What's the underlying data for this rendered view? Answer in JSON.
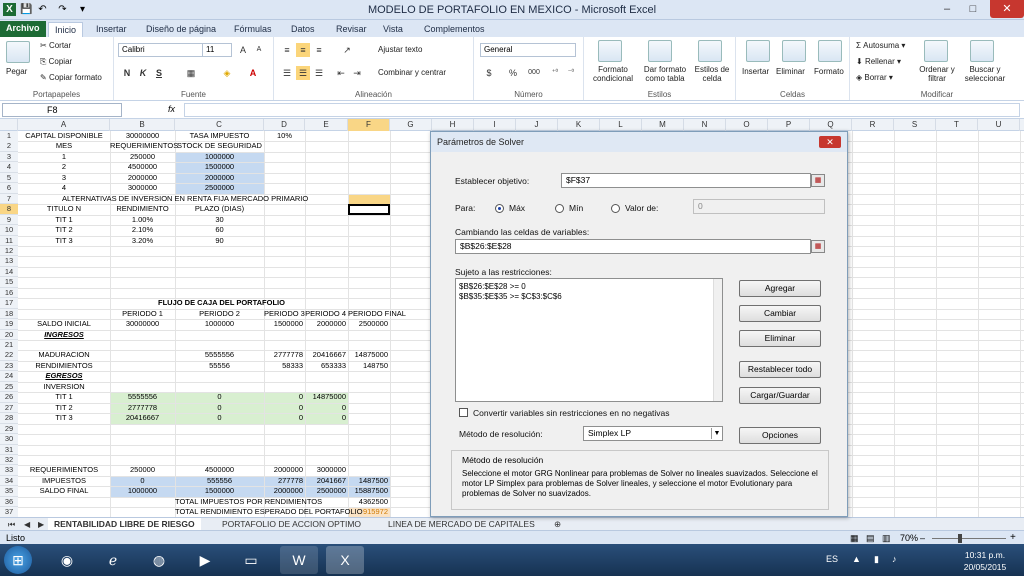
{
  "app": {
    "title": "MODELO DE PORTAFOLIO EN MEXICO  -  Microsoft Excel",
    "minimize": "–",
    "maximize": "□",
    "close": "✕"
  },
  "qat": {
    "save": "💾",
    "undo": "↶",
    "redo": "↷",
    "customize": "▾"
  },
  "tabs": [
    "Archivo",
    "Inicio",
    "Insertar",
    "Diseño de página",
    "Fórmulas",
    "Datos",
    "Revisar",
    "Vista",
    "Complementos"
  ],
  "ribbon": {
    "portapapeles": {
      "label": "Portapapeles",
      "pegar": "Pegar",
      "cortar": "Cortar",
      "copiar": "Copiar",
      "copiar_formato": "Copiar formato"
    },
    "fuente": {
      "label": "Fuente",
      "font": "Calibri",
      "size": "11",
      "bold": "N",
      "italic": "K",
      "underline": "S"
    },
    "alineacion": {
      "label": "Alineación",
      "ajustar": "Ajustar texto",
      "combinar": "Combinar y centrar"
    },
    "numero": {
      "label": "Número",
      "format": "General",
      "currency": "$",
      "percent": "%",
      "thousands": "000"
    },
    "estilos": {
      "label": "Estilos",
      "formato_condicional": "Formato condicional",
      "dar_formato": "Dar formato como tabla",
      "estilos_celda": "Estilos de celda"
    },
    "celdas": {
      "label": "Celdas",
      "insertar": "Insertar",
      "eliminar": "Eliminar",
      "formato": "Formato"
    },
    "modificar": {
      "label": "Modificar",
      "autosuma": "Autosuma",
      "rellenar": "Rellenar",
      "borrar": "Borrar",
      "ordenar": "Ordenar y filtrar",
      "buscar": "Buscar y seleccionar"
    }
  },
  "formula_bar": {
    "name_box": "F8",
    "fx": "fx",
    "value": ""
  },
  "columns": [
    "A",
    "B",
    "C",
    "D",
    "E",
    "F",
    "G",
    "H",
    "I",
    "J",
    "K",
    "L",
    "M",
    "N",
    "O",
    "P",
    "Q",
    "R",
    "S",
    "T",
    "U"
  ],
  "rows": [
    "1",
    "2",
    "3",
    "4",
    "5",
    "6",
    "7",
    "8",
    "9",
    "10",
    "11",
    "12",
    "13",
    "14",
    "15",
    "16",
    "17",
    "18",
    "19",
    "20",
    "21",
    "22",
    "23",
    "24",
    "25",
    "26",
    "27",
    "28",
    "29",
    "30",
    "31",
    "32",
    "33",
    "34",
    "35",
    "36",
    "37"
  ],
  "cells": {
    "a1": "CAPITAL DISPONIBLE",
    "b1": "30000000",
    "c1": "TASA IMPUESTO",
    "d1": "10%",
    "a2": "MES",
    "b2": "REQUERIMIENTOS",
    "c2": "STOCK DE SEGURIDAD",
    "a3": "1",
    "b3": "250000",
    "c3": "1000000",
    "a4": "2",
    "b4": "4500000",
    "c4": "1500000",
    "a5": "3",
    "b5": "2000000",
    "c5": "2000000",
    "a6": "4",
    "b6": "3000000",
    "c6": "2500000",
    "a7": "ALTERNATIVAS DE INVERSION EN RENTA FIJA MERCADO PRIMARIO",
    "a8": "TITULO N",
    "b8": "RENDIMIENTO",
    "c8": "PLAZO (DIAS)",
    "a9": "TIT 1",
    "b9": "1.00%",
    "c9": "30",
    "a10": "TIT 2",
    "b10": "2.10%",
    "c10": "60",
    "a11": "TIT 3",
    "b11": "3.20%",
    "c11": "90",
    "b17": "FLUJO DE CAJA DEL PORTAFOLIO",
    "b18": "PERIODO 1",
    "c18": "PERIODO 2",
    "d18": "PERIODO 3",
    "e18": "PERIODO 4",
    "f18": "PERIODO FINAL",
    "a19": "SALDO INICIAL",
    "b19": "30000000",
    "c19": "1000000",
    "d19": "1500000",
    "e19": "2000000",
    "f19": "2500000",
    "a20": "INGRESOS",
    "a22": "MADURACION",
    "c22": "5555556",
    "d22": "2777778",
    "e22": "20416667",
    "f22": "14875000",
    "a23": "RENDIMIENTOS",
    "c23": "55556",
    "d23": "58333",
    "e23": "653333",
    "f23": "148750",
    "a24": "EGRESOS",
    "a25": "INVERSION",
    "a26": "TIT 1",
    "b26": "5555556",
    "c26": "0",
    "d26": "0",
    "e26": "14875000",
    "a27": "TIT 2",
    "b27": "2777778",
    "c27": "0",
    "d27": "0",
    "e27": "0",
    "a28": "TIT 3",
    "b28": "20416667",
    "c28": "0",
    "d28": "0",
    "e28": "0",
    "a33": "REQUERIMIENTOS",
    "b33": "250000",
    "c33": "4500000",
    "d33": "2000000",
    "e33": "3000000",
    "a34": "IMPUESTOS",
    "b34": "0",
    "c34": "555556",
    "d34": "277778",
    "e34": "2041667",
    "f34": "1487500",
    "a35": "SALDO FINAL",
    "b35": "1000000",
    "c35": "1500000",
    "d35": "2000000",
    "e35": "2500000",
    "f35": "15887500",
    "c36": "TOTAL IMPUESTOS POR RENDIMIENTOS",
    "f36": "4362500",
    "c37": "TOTAL RENDIMIENTO ESPERADO DEL PORTAFOLIO",
    "f37": "915972"
  },
  "sheet_tabs": [
    "RENTABILIDAD LIBRE DE RIESGO",
    "PORTAFOLIO DE ACCION OPTIMO",
    "LINEA DE MERCADO DE CAPITALES"
  ],
  "status": {
    "ready": "Listo",
    "zoom": "70%",
    "zoom_minus": "–",
    "zoom_plus": "+"
  },
  "taskbar": {
    "lang": "ES",
    "time": "10:31 p.m.",
    "date": "20/05/2015"
  },
  "solver": {
    "title": "Parámetros de Solver",
    "objective_label": "Establecer objetivo:",
    "objective": "$F$37",
    "para_label": "Para:",
    "max": "Máx",
    "min": "Mín",
    "valor": "Valor de:",
    "valor_value": "0",
    "variables_label": "Cambiando las celdas de variables:",
    "variables": "$B$26:$E$28",
    "constraints_label": "Sujeto a las restricciones:",
    "constraints": [
      "$B$26:$E$28 >= 0",
      "$B$35:$E$35 >= $C$3:$C$6"
    ],
    "agregar": "Agregar",
    "cambiar": "Cambiar",
    "eliminar": "Eliminar",
    "restablecer": "Restablecer todo",
    "cargar": "Cargar/Guardar",
    "nonneg": "Convertir variables sin restricciones en no negativas",
    "method_label": "Método de resolución:",
    "method": "Simplex LP",
    "opciones": "Opciones",
    "method_title": "Método de resolución",
    "method_desc": "Seleccione el motor GRG Nonlinear para problemas de Solver no lineales suavizados. Seleccione el motor LP Simplex para problemas de Solver lineales, y seleccione el motor Evolutionary para problemas de Solver no suavizados."
  }
}
